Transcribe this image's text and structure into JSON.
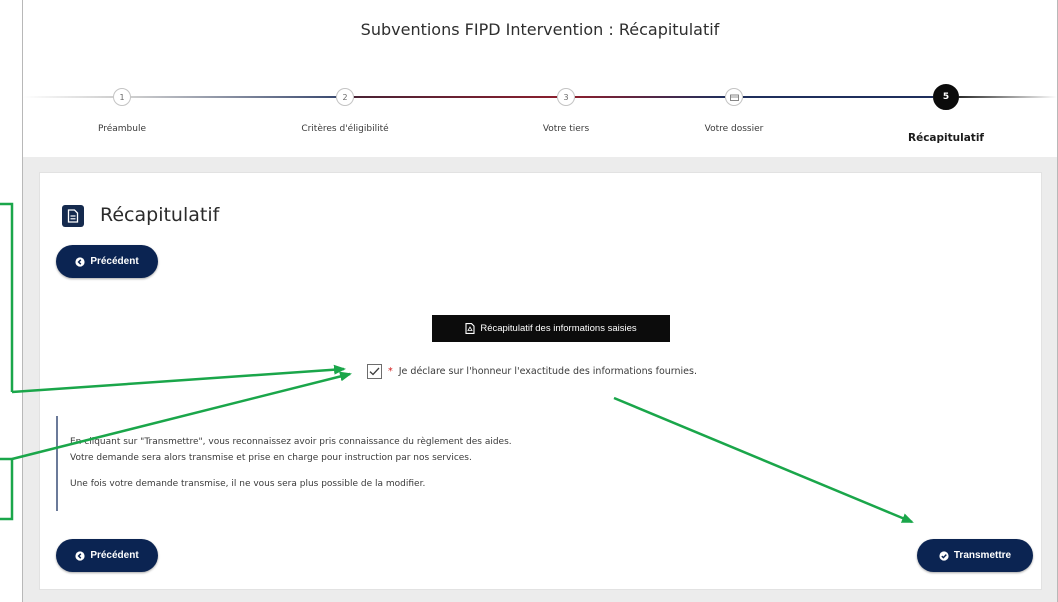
{
  "page": {
    "title": "Subventions FIPD Intervention : Récapitulatif"
  },
  "steps": [
    {
      "number": "1",
      "label": "Préambule",
      "state": "done"
    },
    {
      "number": "2",
      "label": "Critères d'éligibilité",
      "state": "done"
    },
    {
      "number": "3",
      "label": "Votre tiers",
      "state": "done"
    },
    {
      "number": "",
      "icon": "folder-icon",
      "label": "Votre dossier",
      "state": "done"
    },
    {
      "number": "5",
      "label": "Récapitulatif",
      "state": "current"
    }
  ],
  "section": {
    "title": "Récapitulatif",
    "icon": "document-icon"
  },
  "buttons": {
    "previous": "Précédent",
    "summary": "Récapitulatif des informations saisies",
    "submit": "Transmettre"
  },
  "declaration": {
    "checked": true,
    "required_mark": "*",
    "label": "Je déclare sur l'honneur l'exactitude des informations fournies."
  },
  "notice": {
    "line1": "En cliquant sur \"Transmettre\", vous reconnaissez avoir pris connaissance du règlement des aides.",
    "line2": "Votre demande sera alors transmise et prise en charge pour instruction par nos services.",
    "line3": "Une fois votre demande transmise, il ne vous sera plus possible de la modifier."
  },
  "colors": {
    "navy": "#0b2452",
    "stepper_red": "#8a1f2e",
    "stepper_navy": "#1f2f5c",
    "annotation_green": "#1aa64a",
    "required_red": "#d01a1a"
  }
}
